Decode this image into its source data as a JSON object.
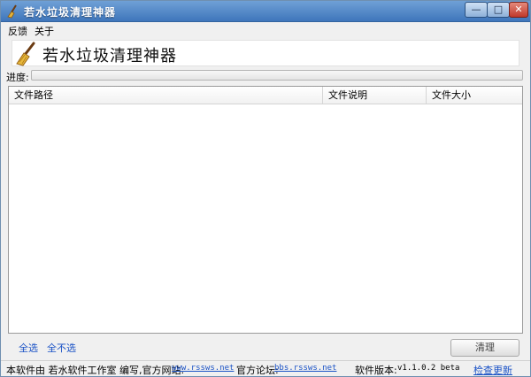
{
  "window": {
    "title": "若水垃圾清理神器",
    "controls": {
      "minimize": "—",
      "maximize": "□",
      "close": "✕"
    }
  },
  "menu": {
    "items": [
      "反馈",
      "关于"
    ]
  },
  "banner": {
    "title": "若水垃圾清理神器"
  },
  "progress": {
    "label": "进度:",
    "value": 0
  },
  "table": {
    "columns": [
      "文件路径",
      "文件说明",
      "文件大小"
    ],
    "rows": []
  },
  "actions": {
    "select_all": "全选",
    "select_none": "全不选",
    "clean_button": "清理"
  },
  "status": {
    "made_by": "本软件由 若水软件工作室 编写,官方网站:",
    "website": "www.rssws.net",
    "forum_label": "官方论坛:",
    "forum": "bbs.rssws.net",
    "version_label": "软件版本:",
    "version": "v1.1.0.2 beta",
    "check_update": "检查更新"
  },
  "colors": {
    "titlebar": "#4f86c6",
    "link": "#1a52c6",
    "progress": "#37c837"
  }
}
